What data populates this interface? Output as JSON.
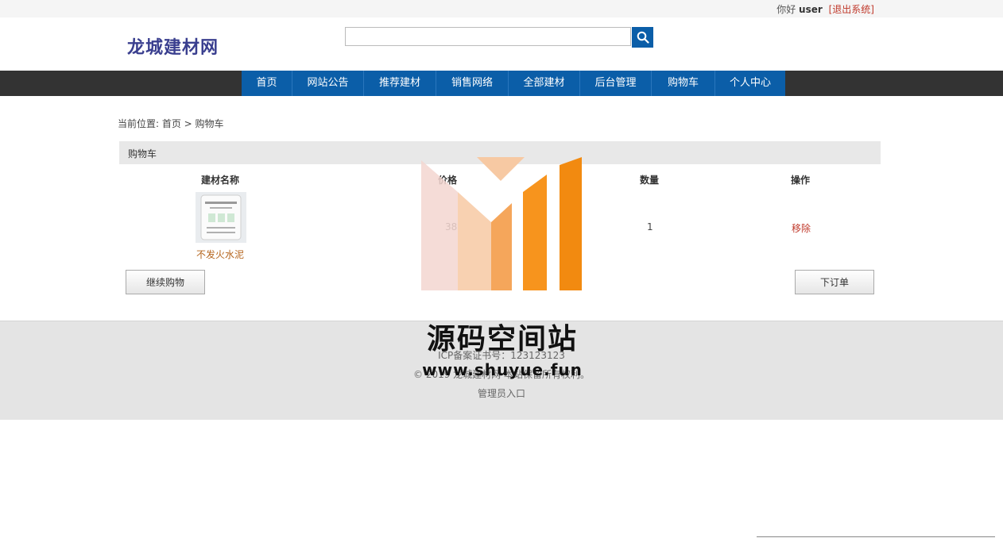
{
  "topbar": {
    "greeting": "你好",
    "username": "user",
    "logout": "[退出系统]"
  },
  "header": {
    "logo": "龙城建材网"
  },
  "search": {
    "placeholder": "",
    "value": ""
  },
  "nav": {
    "items": [
      "首页",
      "网站公告",
      "推荐建材",
      "销售网络",
      "全部建材",
      "后台管理",
      "购物车",
      "个人中心"
    ]
  },
  "breadcrumb": {
    "text": "当前位置: 首页 > 购物车"
  },
  "cart": {
    "title": "购物车",
    "headers": {
      "name": "建材名称",
      "price": "价格",
      "qty": "数量",
      "action": "操作"
    },
    "rows": [
      {
        "name": "不发火水泥",
        "price": "38",
        "qty": "1",
        "action": "移除"
      }
    ],
    "continue_label": "继续购物",
    "order_label": "下订单"
  },
  "footer": {
    "icp": "ICP备案证书号：123123123",
    "copyright": "© 2019 龙城建材网 本站保留所有权利。",
    "admin": "管理员入口"
  },
  "watermark": {
    "title": "源码空间站",
    "url": "www.shuyue.fun"
  },
  "colors": {
    "nav_blue": "#0b5ea8",
    "nav_dark": "#333333",
    "accent": "#f7941d"
  }
}
